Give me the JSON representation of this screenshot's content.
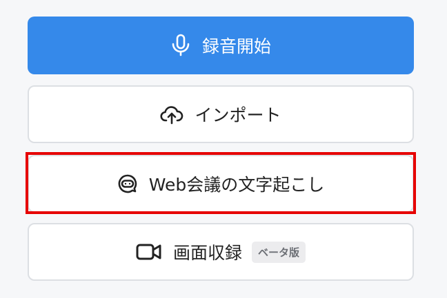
{
  "buttons": {
    "record": {
      "label": "録音開始",
      "icon": "microphone-icon"
    },
    "import": {
      "label": "インポート",
      "icon": "cloud-upload-icon"
    },
    "web_meeting": {
      "label": "Web会議の文字起こし",
      "icon": "bot-icon"
    },
    "screen_record": {
      "label": "画面収録",
      "icon": "video-camera-icon",
      "badge": "ベータ版"
    }
  },
  "colors": {
    "primary": "#3589ea",
    "highlight": "#e60000",
    "border": "#dcdfe3",
    "background": "#f6f7f9"
  }
}
